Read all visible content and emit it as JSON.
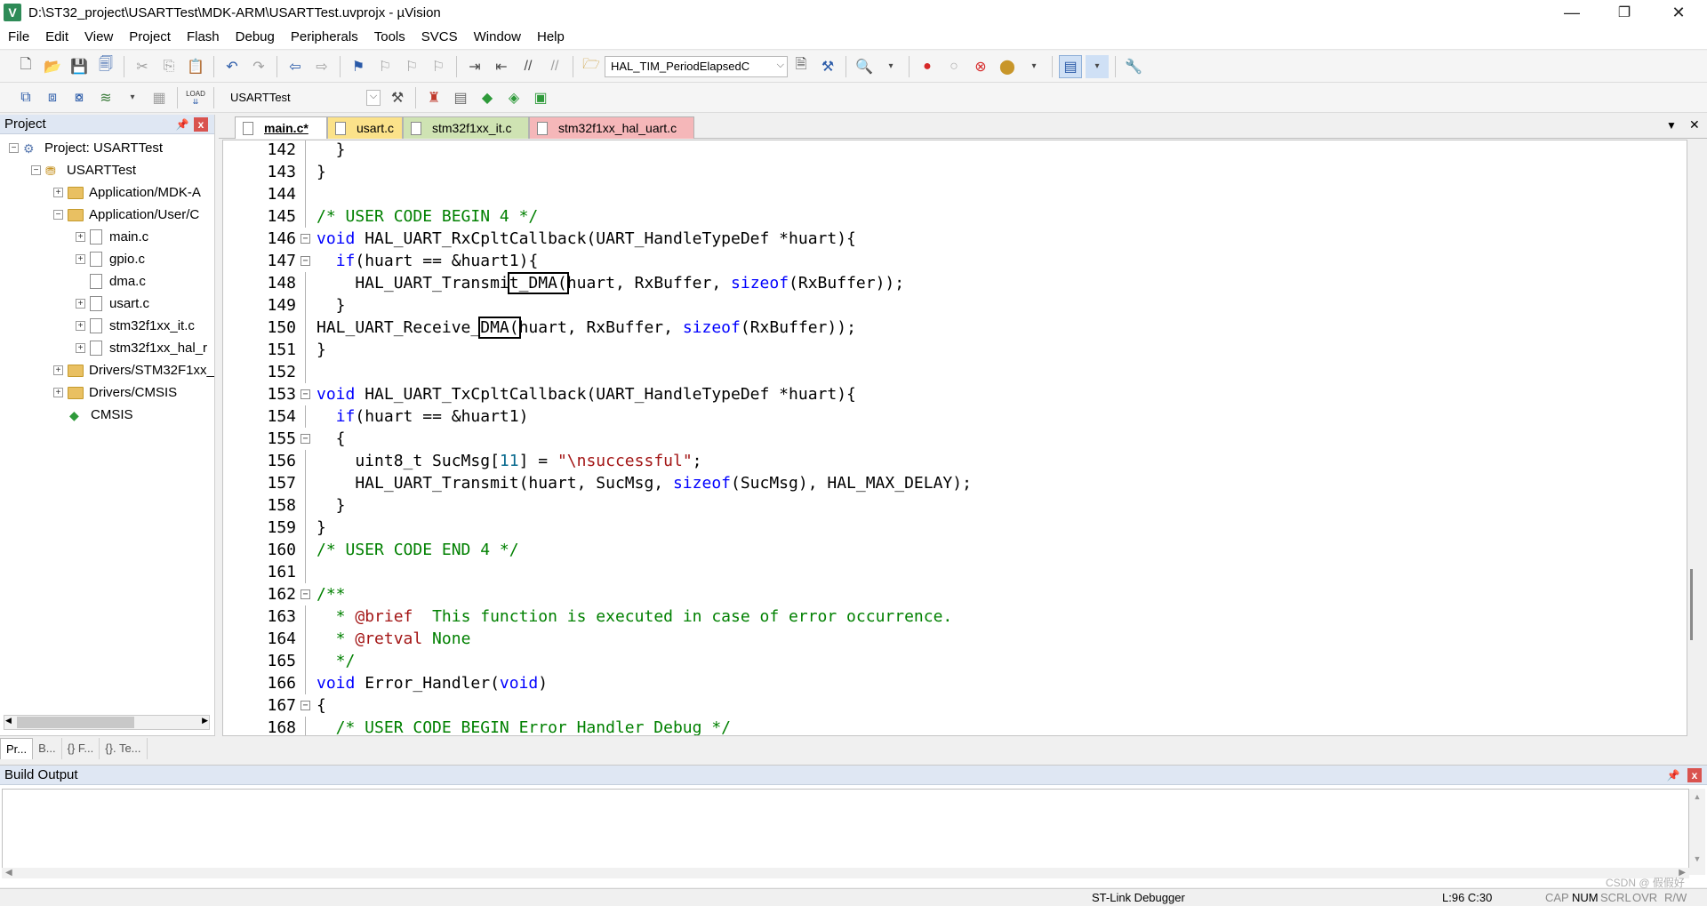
{
  "window": {
    "title": "D:\\ST32_project\\USARTTest\\MDK-ARM\\USARTTest.uvprojx - µVision",
    "app_icon_letter": "V",
    "minimize": "—",
    "restore": "❐",
    "close": "✕"
  },
  "menu": [
    "File",
    "Edit",
    "View",
    "Project",
    "Flash",
    "Debug",
    "Peripherals",
    "Tools",
    "SVCS",
    "Window",
    "Help"
  ],
  "toolbar1": {
    "find_combo": "HAL_TIM_PeriodElapsedC"
  },
  "toolbar2": {
    "target_combo": "USARTTest",
    "load_label": "LOAD"
  },
  "project_panel": {
    "title": "Project",
    "pin": "ᵖ",
    "close": "x",
    "tree": [
      {
        "label": "Project: USARTTest",
        "level": 0,
        "kind": "root",
        "expander": "−"
      },
      {
        "label": "USARTTest",
        "level": 1,
        "kind": "target",
        "expander": "−"
      },
      {
        "label": "Application/MDK-A",
        "level": 2,
        "kind": "folder",
        "expander": "+"
      },
      {
        "label": "Application/User/C",
        "level": 2,
        "kind": "folder",
        "expander": "−"
      },
      {
        "label": "main.c",
        "level": 3,
        "kind": "file",
        "expander": "+"
      },
      {
        "label": "gpio.c",
        "level": 3,
        "kind": "file",
        "expander": "+"
      },
      {
        "label": "dma.c",
        "level": 3,
        "kind": "file",
        "expander": ""
      },
      {
        "label": "usart.c",
        "level": 3,
        "kind": "file",
        "expander": "+"
      },
      {
        "label": "stm32f1xx_it.c",
        "level": 3,
        "kind": "file",
        "expander": "+"
      },
      {
        "label": "stm32f1xx_hal_r",
        "level": 3,
        "kind": "file",
        "expander": "+"
      },
      {
        "label": "Drivers/STM32F1xx_",
        "level": 2,
        "kind": "folder",
        "expander": "+"
      },
      {
        "label": "Drivers/CMSIS",
        "level": 2,
        "kind": "folder",
        "expander": "+"
      },
      {
        "label": "CMSIS",
        "level": 2,
        "kind": "gem",
        "expander": ""
      }
    ],
    "tabs": [
      "Pr...",
      "B...",
      "{} F...",
      "{}. Te..."
    ]
  },
  "editor": {
    "tabs": [
      {
        "label": "main.c*",
        "bg": "#ffffff",
        "active": true
      },
      {
        "label": "usart.c",
        "bg": "#fbe28a",
        "active": false
      },
      {
        "label": "stm32f1xx_it.c",
        "bg": "#cfe3b3",
        "active": false
      },
      {
        "label": "stm32f1xx_hal_uart.c",
        "bg": "#f5b7b9",
        "active": false
      }
    ],
    "tab_menu": "▼",
    "tab_close": "✕",
    "lines": [
      {
        "n": "142",
        "fold": "",
        "segments": [
          {
            "t": "  }",
            "c": ""
          }
        ]
      },
      {
        "n": "143",
        "fold": "",
        "segments": [
          {
            "t": "}",
            "c": ""
          }
        ]
      },
      {
        "n": "144",
        "fold": "",
        "segments": []
      },
      {
        "n": "145",
        "fold": "",
        "segments": [
          {
            "t": "/* USER CODE BEGIN 4 */",
            "c": "cm"
          }
        ]
      },
      {
        "n": "146",
        "fold": "−",
        "segments": [
          {
            "t": "void",
            "c": "kw"
          },
          {
            "t": " HAL_UART_RxCpltCallback(UART_HandleTypeDef *huart){",
            "c": ""
          }
        ]
      },
      {
        "n": "147",
        "fold": "−",
        "segments": [
          {
            "t": "  ",
            "c": ""
          },
          {
            "t": "if",
            "c": "kw"
          },
          {
            "t": "(huart == &huart1){",
            "c": ""
          }
        ]
      },
      {
        "n": "148",
        "fold": "",
        "segments": [
          {
            "t": "    HAL_UART_Transmi",
            "c": ""
          },
          {
            "t": "t_DMA(",
            "c": "boxed"
          },
          {
            "t": "huart, RxBuffer, ",
            "c": ""
          },
          {
            "t": "sizeof",
            "c": "kw"
          },
          {
            "t": "(RxBuffer));",
            "c": ""
          }
        ]
      },
      {
        "n": "149",
        "fold": "",
        "segments": [
          {
            "t": "  }",
            "c": ""
          }
        ]
      },
      {
        "n": "150",
        "fold": "",
        "segments": [
          {
            "t": "HAL_UART_Receive_",
            "c": ""
          },
          {
            "t": "DMA(",
            "c": "boxed"
          },
          {
            "t": "huart, RxBuffer, ",
            "c": ""
          },
          {
            "t": "sizeof",
            "c": "kw"
          },
          {
            "t": "(RxBuffer));",
            "c": ""
          }
        ]
      },
      {
        "n": "151",
        "fold": "",
        "segments": [
          {
            "t": "}",
            "c": ""
          }
        ]
      },
      {
        "n": "152",
        "fold": "",
        "segments": []
      },
      {
        "n": "153",
        "fold": "−",
        "segments": [
          {
            "t": "void",
            "c": "kw"
          },
          {
            "t": " HAL_UART_TxCpltCallback(UART_HandleTypeDef *huart){",
            "c": ""
          }
        ]
      },
      {
        "n": "154",
        "fold": "",
        "segments": [
          {
            "t": "  ",
            "c": ""
          },
          {
            "t": "if",
            "c": "kw"
          },
          {
            "t": "(huart == &huart1)",
            "c": ""
          }
        ]
      },
      {
        "n": "155",
        "fold": "−",
        "segments": [
          {
            "t": "  {",
            "c": ""
          }
        ]
      },
      {
        "n": "156",
        "fold": "",
        "segments": [
          {
            "t": "    uint8_t SucMsg[",
            "c": ""
          },
          {
            "t": "11",
            "c": "num"
          },
          {
            "t": "] = ",
            "c": ""
          },
          {
            "t": "\"\\nsuccessful\"",
            "c": "str"
          },
          {
            "t": ";",
            "c": ""
          }
        ]
      },
      {
        "n": "157",
        "fold": "",
        "segments": [
          {
            "t": "    HAL_UART_Transmit(huart, SucMsg, ",
            "c": ""
          },
          {
            "t": "sizeof",
            "c": "kw"
          },
          {
            "t": "(SucMsg), HAL_MAX_DELAY);",
            "c": ""
          }
        ]
      },
      {
        "n": "158",
        "fold": "",
        "segments": [
          {
            "t": "  }",
            "c": ""
          }
        ]
      },
      {
        "n": "159",
        "fold": "",
        "segments": [
          {
            "t": "}",
            "c": ""
          }
        ]
      },
      {
        "n": "160",
        "fold": "",
        "segments": [
          {
            "t": "/* USER CODE END 4 */",
            "c": "cm"
          }
        ]
      },
      {
        "n": "161",
        "fold": "",
        "segments": []
      },
      {
        "n": "162",
        "fold": "−",
        "segments": [
          {
            "t": "/**",
            "c": "cm"
          }
        ]
      },
      {
        "n": "163",
        "fold": "",
        "segments": [
          {
            "t": "  * ",
            "c": "cm"
          },
          {
            "t": "@brief",
            "c": "str"
          },
          {
            "t": "  This function is executed in case of error occurrence.",
            "c": "cm"
          }
        ]
      },
      {
        "n": "164",
        "fold": "",
        "segments": [
          {
            "t": "  * ",
            "c": "cm"
          },
          {
            "t": "@retval",
            "c": "str"
          },
          {
            "t": " None",
            "c": "cm"
          }
        ]
      },
      {
        "n": "165",
        "fold": "",
        "segments": [
          {
            "t": "  */",
            "c": "cm"
          }
        ]
      },
      {
        "n": "166",
        "fold": "",
        "segments": [
          {
            "t": "void",
            "c": "kw"
          },
          {
            "t": " Error_Handler(",
            "c": ""
          },
          {
            "t": "void",
            "c": "kw"
          },
          {
            "t": ")",
            "c": ""
          }
        ]
      },
      {
        "n": "167",
        "fold": "−",
        "segments": [
          {
            "t": "{",
            "c": ""
          }
        ]
      },
      {
        "n": "168",
        "fold": "",
        "segments": [
          {
            "t": "  /* USER CODE BEGIN Error_Handler_Debug */",
            "c": "cm"
          }
        ]
      }
    ]
  },
  "build_output": {
    "title": "Build Output",
    "pin": "ᵖ",
    "close": "x"
  },
  "status": {
    "debugger": "ST-Link Debugger",
    "position": "L:96 C:30",
    "cap": "CAP",
    "num": "NUM",
    "scrl": "SCRL",
    "ovr": "OVR",
    "rw": "R/W",
    "watermark": "CSDN @ 假假好"
  },
  "colors": {
    "keyword": "#0000ff",
    "comment": "#008000",
    "string": "#a31515",
    "number": "#0b6b8f",
    "panel_header": "#dfe7f3"
  }
}
